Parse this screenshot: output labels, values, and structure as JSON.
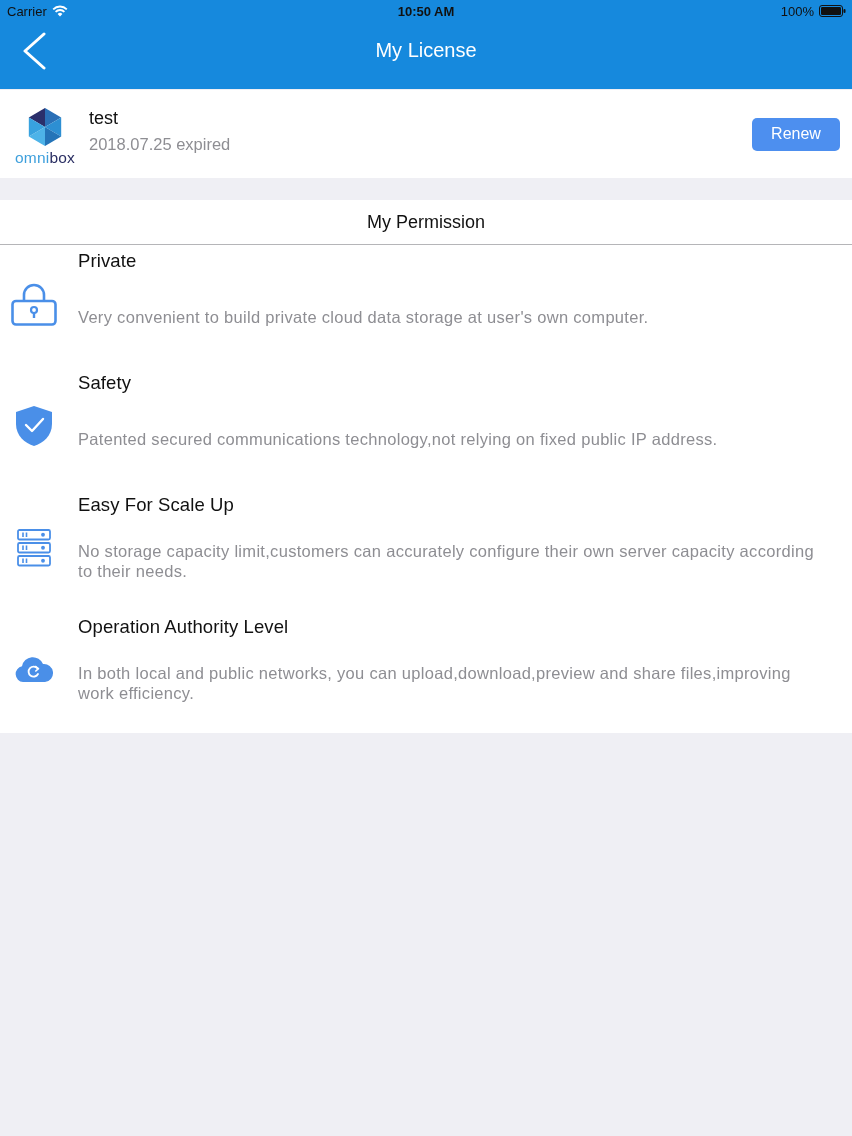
{
  "status_bar": {
    "carrier": "Carrier",
    "time": "10:50 AM",
    "battery": "100%"
  },
  "nav_bar": {
    "title": "My License"
  },
  "license": {
    "wordmark": [
      "omni",
      "box"
    ],
    "name": "test",
    "status": "2018.07.25 expired",
    "button": "Renew"
  },
  "permissions": {
    "title": "My Permission",
    "items": [
      {
        "title": "Private",
        "description": "Very convenient to build private cloud data storage at user's own computer."
      },
      {
        "title": "Safety",
        "description": "Patented secured communications technology,not relying on fixed public IP address."
      },
      {
        "title": "Easy For Scale Up",
        "description": "No storage capacity limit,customers can accurately configure their own server capacity according to their needs."
      },
      {
        "title": "Operation Authority Level",
        "description": "In both local and public networks, you can upload,download,preview and share files,improving work efficiency."
      }
    ]
  }
}
